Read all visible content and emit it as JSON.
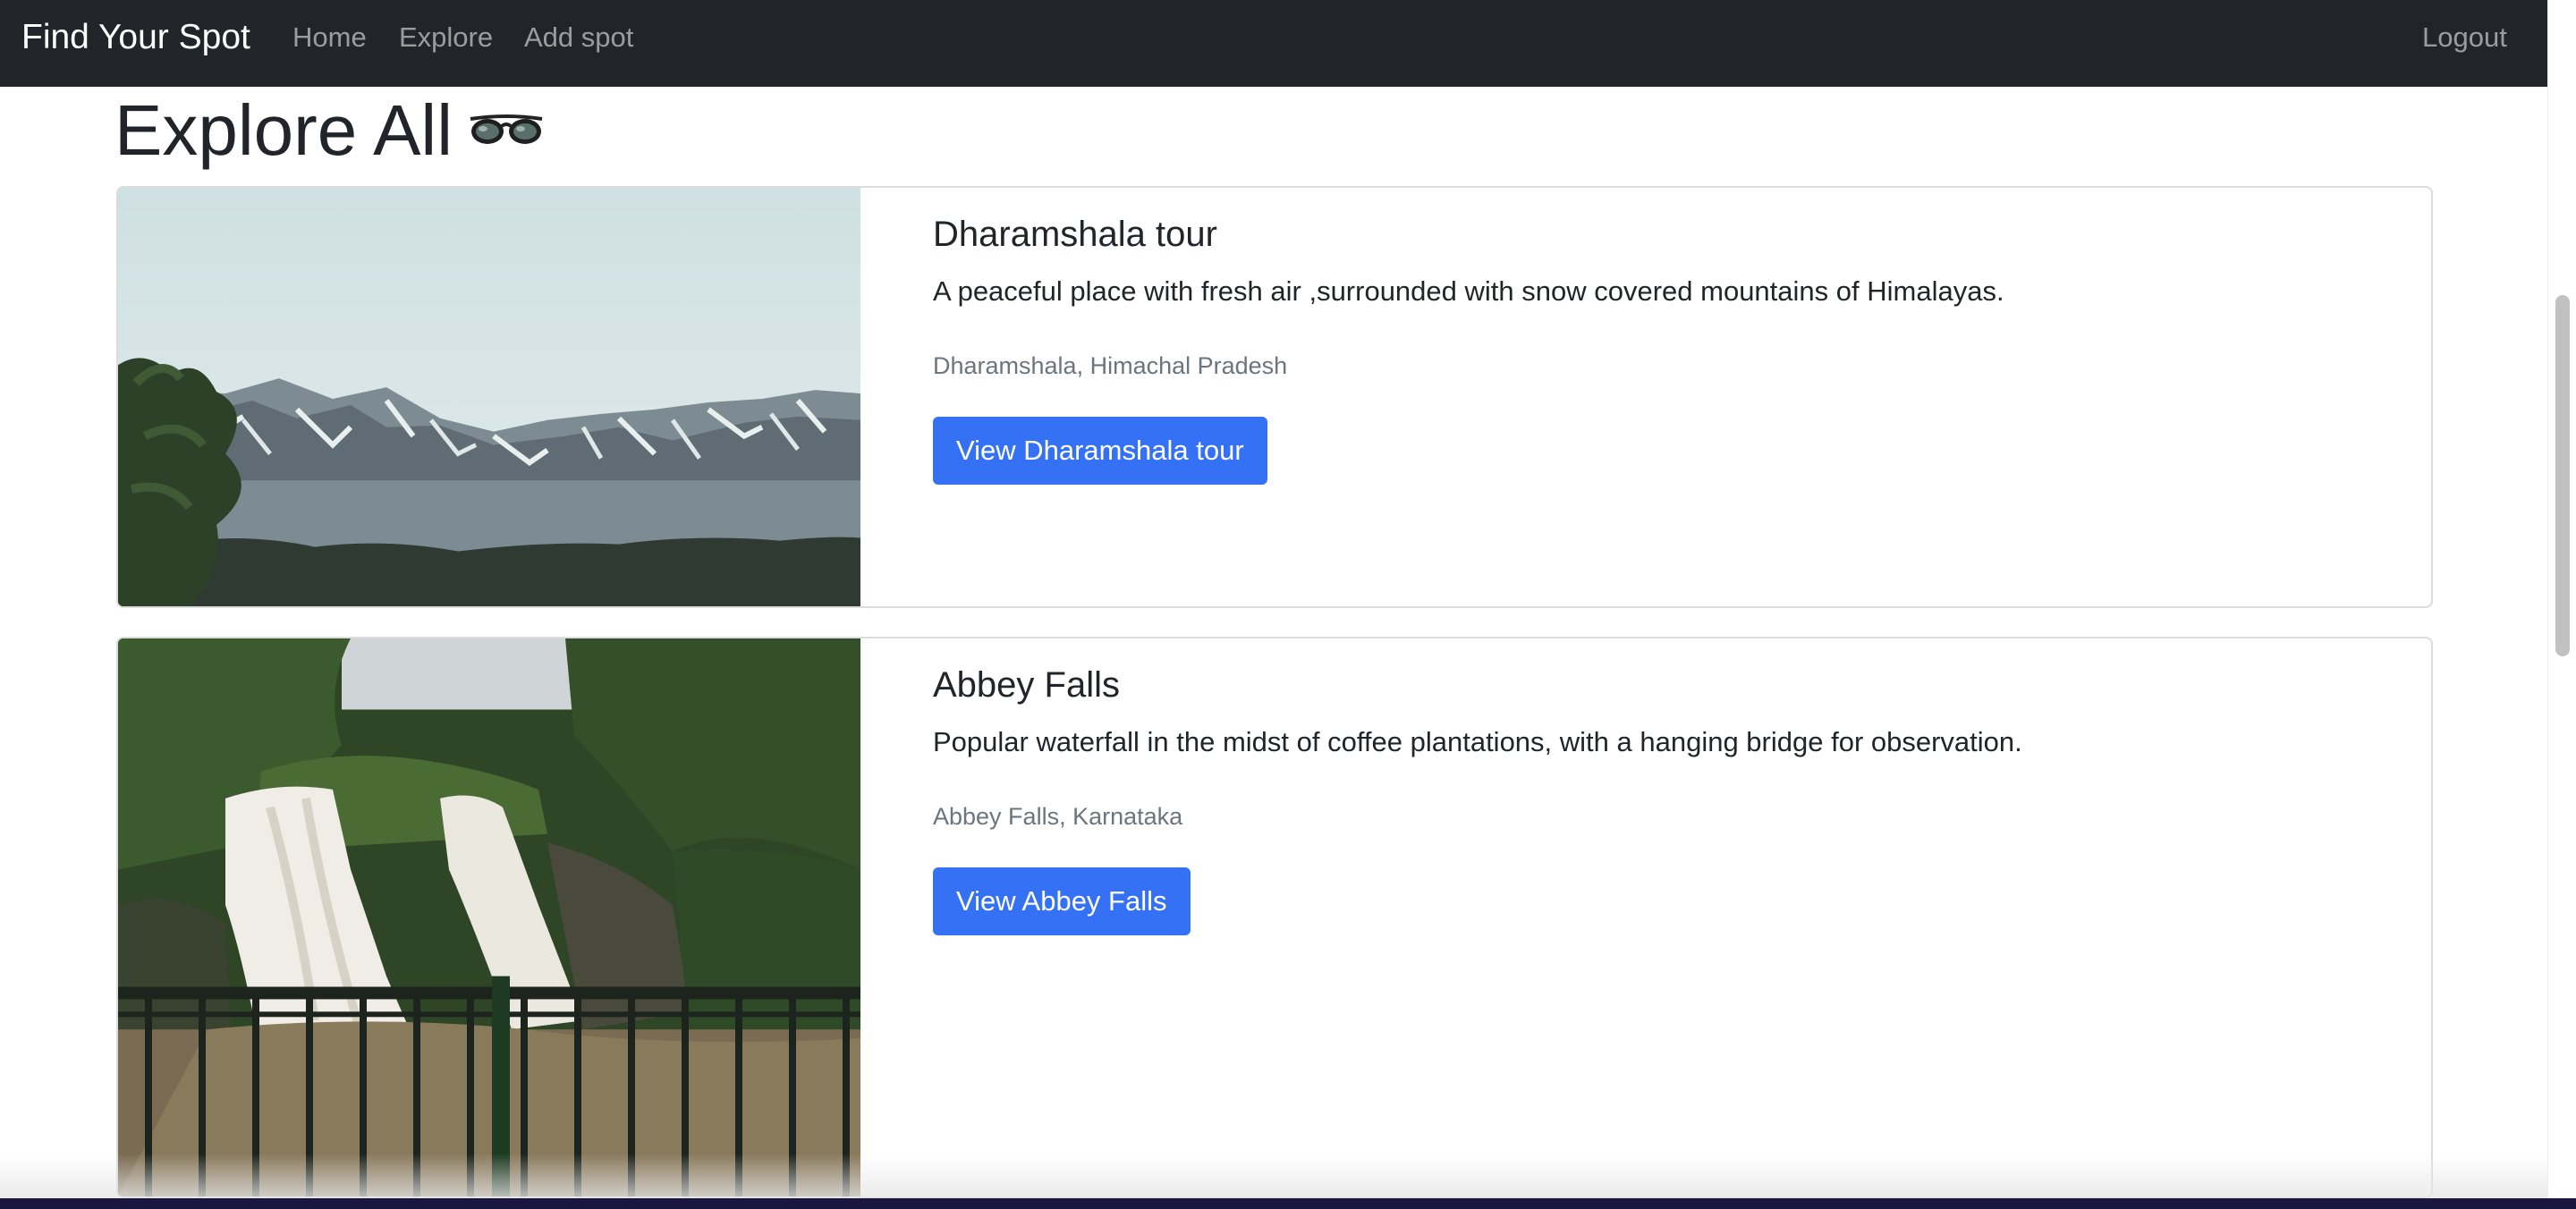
{
  "navbar": {
    "brand": "Find Your Spot",
    "links": [
      {
        "label": "Home"
      },
      {
        "label": "Explore"
      },
      {
        "label": "Add spot"
      }
    ],
    "logout": "Logout"
  },
  "page": {
    "title": "Explore All",
    "title_icon": "sunglasses-icon"
  },
  "spots": [
    {
      "title": "Dharamshala tour",
      "description": "A peaceful place with fresh air ,surrounded with snow covered mountains of Himalayas.",
      "location": "Dharamshala, Himachal Pradesh",
      "button_label": "View Dharamshala tour",
      "image": "snow-mountain-photo"
    },
    {
      "title": "Abbey Falls",
      "description": "Popular waterfall in the midst of coffee plantations, with a hanging bridge for observation.",
      "location": "Abbey Falls, Karnataka",
      "button_label": "View Abbey Falls",
      "image": "waterfall-photo"
    }
  ],
  "colors": {
    "navbar_bg": "#212529",
    "primary_button": "#3471f5",
    "muted_text": "#6c757d"
  }
}
